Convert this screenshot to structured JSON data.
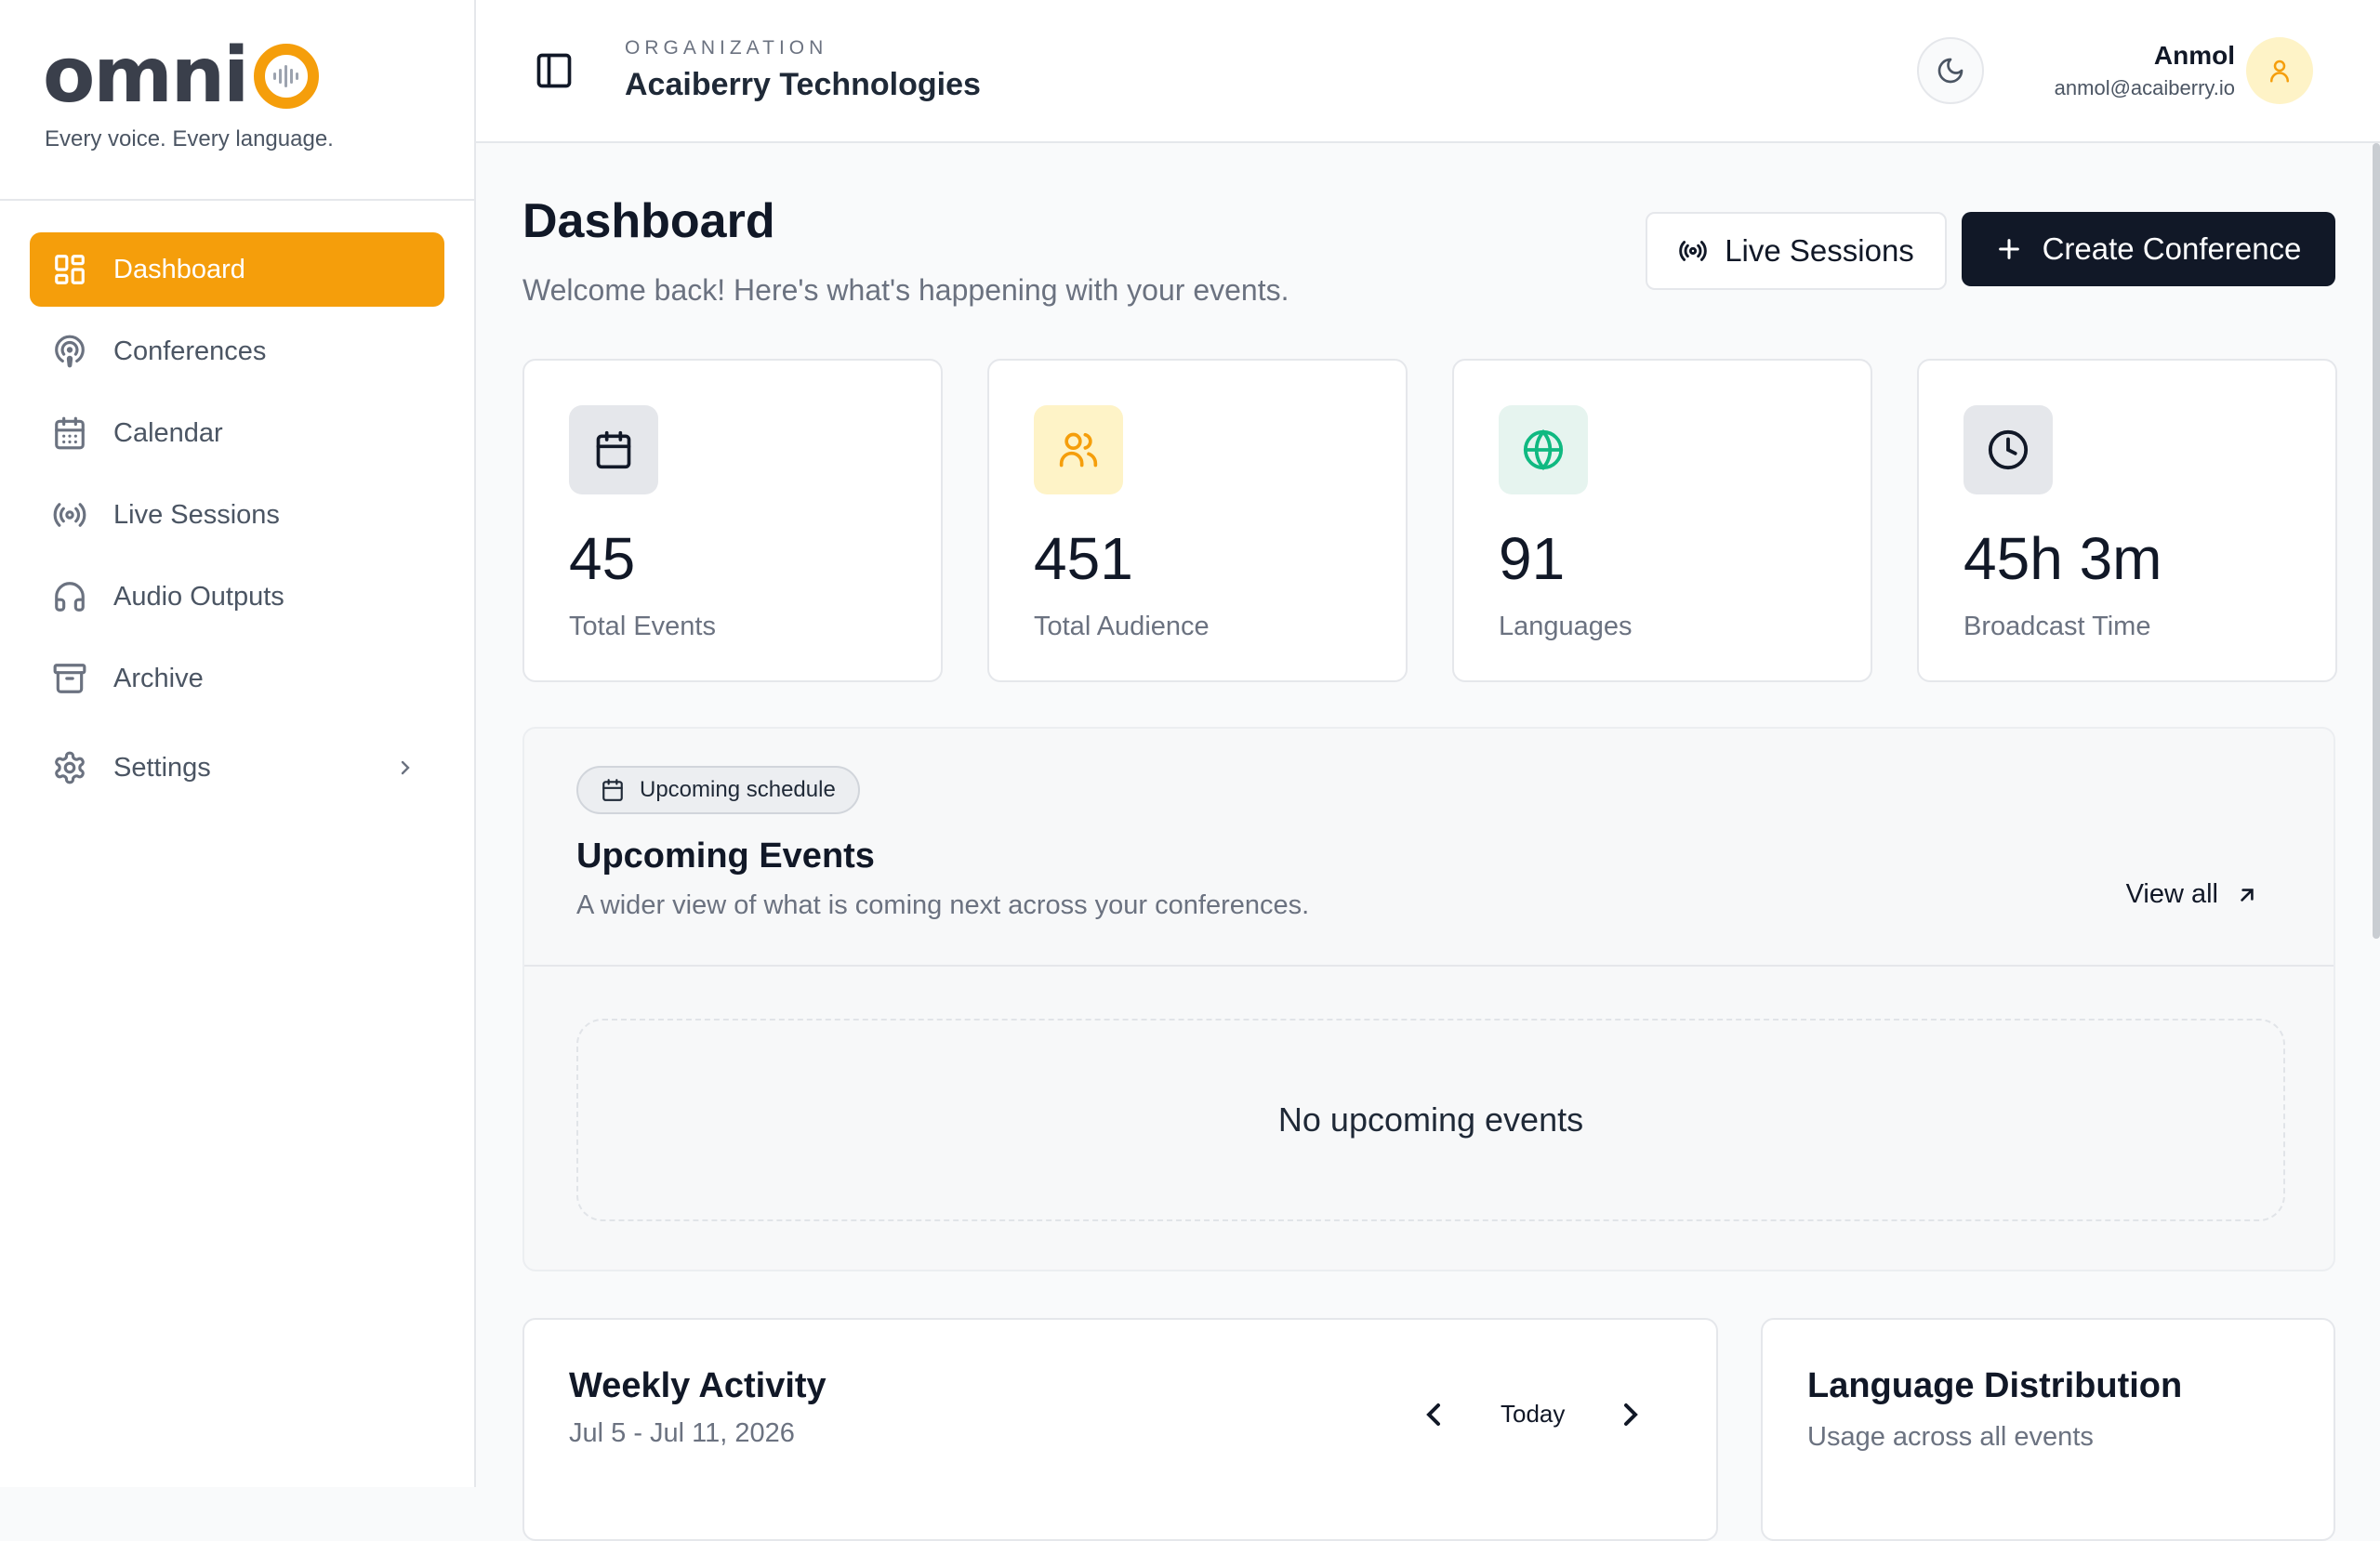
{
  "brand": {
    "logo_text": "OMNIO",
    "tagline": "Every voice. Every language.",
    "accent_color": "#f59e0b"
  },
  "sidebar": {
    "items": [
      {
        "label": "Dashboard",
        "icon": "dashboard-grid-icon",
        "active": true
      },
      {
        "label": "Conferences",
        "icon": "podcast-icon"
      },
      {
        "label": "Calendar",
        "icon": "calendar-icon"
      },
      {
        "label": "Live Sessions",
        "icon": "broadcast-icon"
      },
      {
        "label": "Audio Outputs",
        "icon": "headphones-icon"
      },
      {
        "label": "Archive",
        "icon": "archive-icon"
      },
      {
        "label": "Settings",
        "icon": "gear-icon"
      }
    ]
  },
  "topbar": {
    "org_label": "ORGANIZATION",
    "org_name": "Acaiberry Technologies",
    "user": {
      "name": "Anmol",
      "email": "anmol@acaiberry.io"
    }
  },
  "main": {
    "title": "Dashboard",
    "subtitle": "Welcome back! Here's what's happening with your events.",
    "live_sessions_label": "Live Sessions",
    "create_conference_label": "Create Conference"
  },
  "stats": [
    {
      "value": "45",
      "label": "Total Events",
      "icon": "calendar-icon",
      "color": "#111827",
      "bg": "#e5e7eb"
    },
    {
      "value": "451",
      "label": "Total Audience",
      "icon": "users-icon",
      "color": "#f59e0b",
      "bg": "#fef3c7"
    },
    {
      "value": "91",
      "label": "Languages",
      "icon": "globe-icon",
      "color": "#10b981",
      "bg": "#e6f4ef"
    },
    {
      "value": "45h 3m",
      "label": "Broadcast Time",
      "icon": "clock-icon",
      "color": "#111827",
      "bg": "#e5e7eb"
    }
  ],
  "upcoming": {
    "pill": "Upcoming schedule",
    "title": "Upcoming Events",
    "subtitle": "A wider view of what is coming next across your conferences.",
    "view_all": "View all",
    "empty": "No upcoming events"
  },
  "weekly": {
    "title": "Weekly Activity",
    "range": "Jul 5 - Jul 11, 2026",
    "today": "Today"
  },
  "language_distribution": {
    "title": "Language Distribution",
    "subtitle": "Usage across all events"
  }
}
